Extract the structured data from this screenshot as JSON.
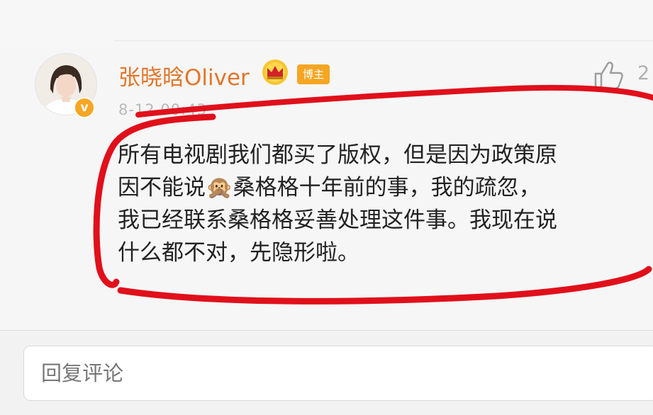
{
  "comment": {
    "username": "张晓晗Oliver",
    "author_tag": "博主",
    "verified_mark": "v",
    "like_count": "2",
    "timestamp": "8-12 00:43",
    "text_lines": [
      "所有电视剧我们都买了版权，但是因为政策原",
      "因不能说🙊桑格格十年前的事，我的疏忽，",
      "我已经联系桑格格妥善处理这件事。我现在说",
      "什么都不对，先隐形啦。"
    ]
  },
  "reply": {
    "placeholder": "回复评论"
  },
  "colors": {
    "username": "#e1762a",
    "author_tag_bg": "#f5a623",
    "annotation": "#e0101b"
  },
  "icons": [
    "avatar",
    "verified-badge",
    "crown-icon",
    "like-icon"
  ]
}
